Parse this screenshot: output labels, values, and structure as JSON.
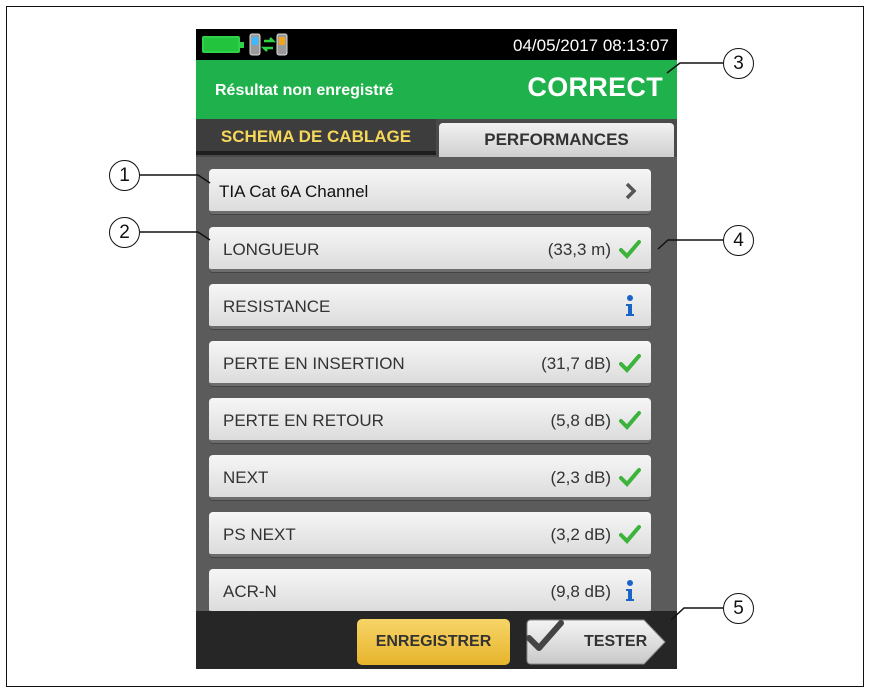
{
  "status_bar": {
    "battery_icon": "battery-full-icon",
    "link_icon": "tester-link-icon",
    "datetime": "04/05/2017 08:13:07"
  },
  "header": {
    "message": "Résultat non enregistré",
    "status": "CORRECT",
    "status_color": "#1fb14b"
  },
  "tabs": [
    {
      "label": "SCHEMA DE CABLAGE",
      "active": true
    },
    {
      "label": "PERFORMANCES",
      "active": false
    }
  ],
  "standard": {
    "label": "TIA Cat 6A Channel",
    "icon": "chevron-right-icon"
  },
  "results": [
    {
      "label": "LONGUEUR",
      "value": "(33,3 m)",
      "icon": "check-icon"
    },
    {
      "label": "RESISTANCE",
      "value": "",
      "icon": "info-icon"
    },
    {
      "label": "PERTE EN INSERTION",
      "value": "(31,7 dB)",
      "icon": "check-icon"
    },
    {
      "label": "PERTE EN RETOUR",
      "value": "(5,8 dB)",
      "icon": "check-icon"
    },
    {
      "label": "NEXT",
      "value": "(2,3 dB)",
      "icon": "check-icon"
    },
    {
      "label": "PS NEXT",
      "value": "(3,2 dB)",
      "icon": "check-icon"
    },
    {
      "label": "ACR-N",
      "value": "(9,8 dB)",
      "icon": "info-icon"
    }
  ],
  "footer": {
    "save_label": "ENREGISTRER",
    "test_label": "TESTER",
    "save_color": "#e7b42c"
  },
  "callouts": [
    "1",
    "2",
    "3",
    "4",
    "5"
  ],
  "colors": {
    "pass_check": "#3cb43c",
    "info": "#1a64c8",
    "active_tab_text": "#f5d75a"
  }
}
